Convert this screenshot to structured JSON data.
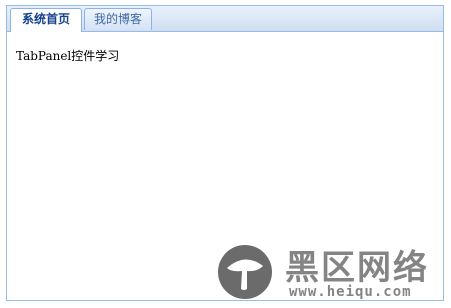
{
  "tabs": [
    {
      "label": "系统首页",
      "active": true
    },
    {
      "label": "我的博客",
      "active": false
    }
  ],
  "content": {
    "text": "TabPanel控件学习"
  },
  "watermark": {
    "title": "黑区网络",
    "url": "www.heiqu.com",
    "logo_icon": "mushroom-logo-icon"
  },
  "colors": {
    "tab_border": "#99bbe8",
    "active_tab_text": "#15428b",
    "inactive_tab_text": "#416aa3"
  }
}
